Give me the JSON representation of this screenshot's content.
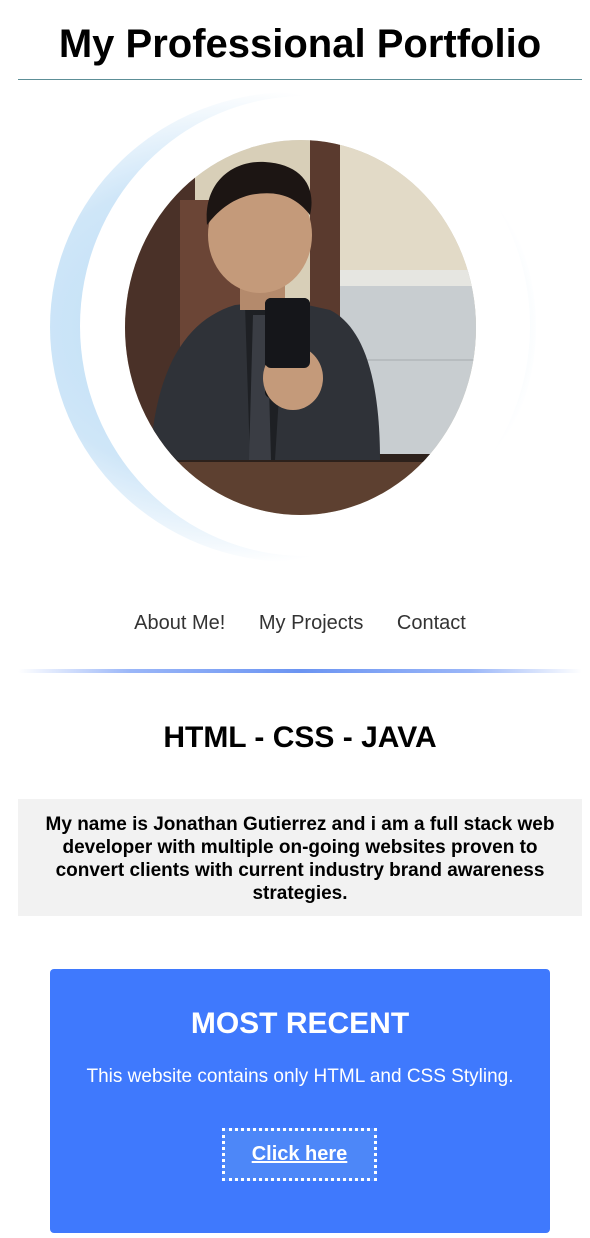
{
  "header": {
    "title": "My Professional Portfolio"
  },
  "profile": {
    "photo": "profile-photo"
  },
  "nav": {
    "items": [
      {
        "label": "About Me!"
      },
      {
        "label": "My Projects"
      },
      {
        "label": "Contact"
      }
    ]
  },
  "skills": {
    "text": "HTML - CSS - JAVA"
  },
  "bio": {
    "text": "My name is Jonathan Gutierrez and i am a full stack web developer with multiple on-going websites proven to convert clients with current industry brand awareness strategies."
  },
  "recent": {
    "title": "MOST RECENT",
    "description": "This website contains only HTML and CSS Styling.",
    "button_label": "Click here"
  },
  "colors": {
    "card_background": "#3f79fd",
    "glow": "#b8dcf5",
    "nav_rule": "#6b94f2"
  }
}
